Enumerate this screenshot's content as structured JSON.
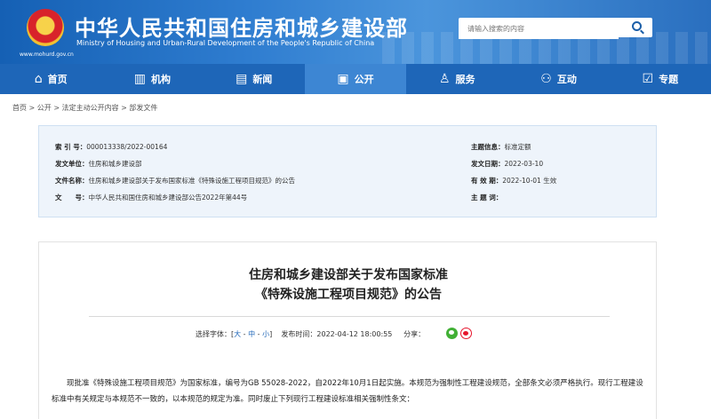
{
  "header": {
    "title": "中华人民共和国住房和城乡建设部",
    "subtitle": "Ministry of Housing and Urban-Rural Development of the People's Republic of China",
    "domain": "www.mohurd.gov.cn",
    "search_placeholder": "请输入搜索的内容"
  },
  "nav": {
    "items": [
      {
        "label": "首页",
        "icon": "home-icon",
        "glyph": "⌂"
      },
      {
        "label": "机构",
        "icon": "building-icon",
        "glyph": "▥"
      },
      {
        "label": "新闻",
        "icon": "news-icon",
        "glyph": "▤"
      },
      {
        "label": "公开",
        "icon": "open-icon",
        "glyph": "▣"
      },
      {
        "label": "服务",
        "icon": "service-icon",
        "glyph": "♙"
      },
      {
        "label": "互动",
        "icon": "interaction-icon",
        "glyph": "⚇"
      },
      {
        "label": "专题",
        "icon": "topic-icon",
        "glyph": "☑"
      }
    ],
    "active_index": 3
  },
  "breadcrumb": [
    "首页",
    "公开",
    "法定主动公开内容",
    "部发文件"
  ],
  "breadcrumb_sep": " > ",
  "info": {
    "index_key": "索 引 号：",
    "index_val": "000013338/2022-00164",
    "issuer_key": "发文单位：",
    "issuer_val": "住房和城乡建设部",
    "filename_key": "文件名称：",
    "filename_val": "住房和城乡建设部关于发布国家标准《特殊设施工程项目规范》的公告",
    "docno_key": "文　　号：",
    "docno_val": "中华人民共和国住房和城乡建设部公告2022年第44号",
    "topic_key": "主题信息：",
    "topic_val": "标准定额",
    "date_key": "发文日期：",
    "date_val": "2022-03-10",
    "valid_key": "有 效 期：",
    "valid_val": "2022-10-01 生效",
    "keywords_key": "主 题 词：",
    "keywords_val": ""
  },
  "article": {
    "title_line1": "住房和城乡建设部关于发布国家标准",
    "title_line2": "《特殊设施工程项目规范》的公告",
    "font_label": "选择字体：[",
    "font_large": "大",
    "font_medium": "中",
    "font_small": "小",
    "font_close": "]",
    "font_sep": " - ",
    "publish_label": "发布时间：",
    "publish_time": "2022-04-12 18:00:55",
    "share_label": "分享：",
    "paragraph1": "现批准《特殊设施工程项目规范》为国家标准，编号为GB 55028-2022，自2022年10月1日起实施。本规范为强制性工程建设规范，全部条文必须严格执行。现行工程建设标准中有关规定与本规范不一致的，以本规范的规定为准。同时废止下列现行工程建设标准相关强制性条文："
  }
}
